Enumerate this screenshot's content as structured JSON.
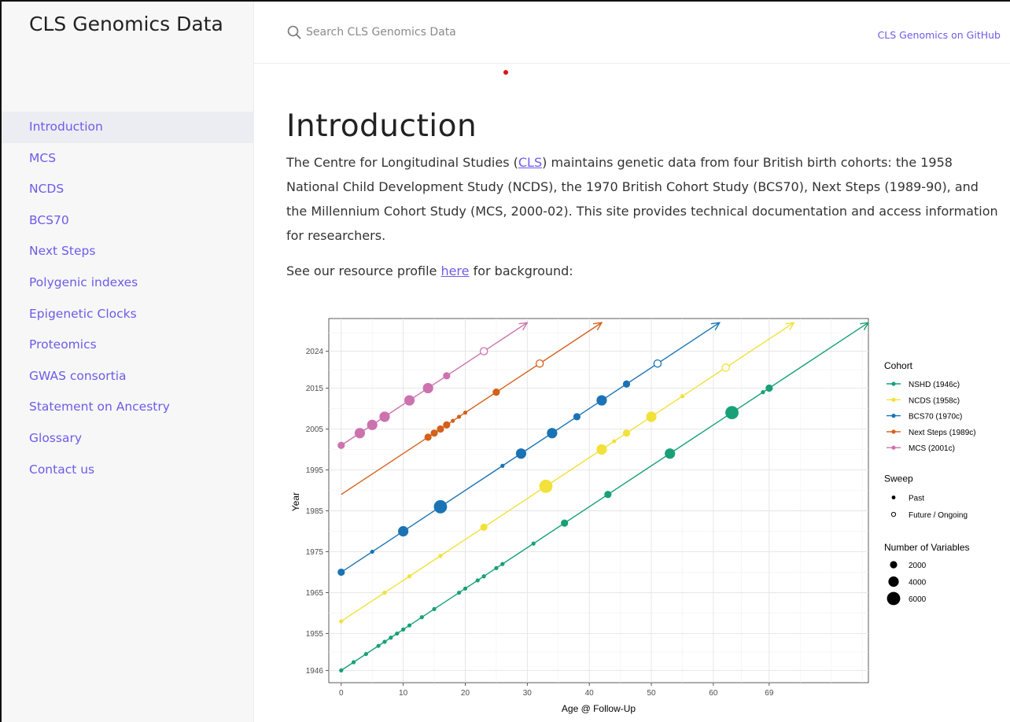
{
  "site": {
    "title": "CLS Genomics Data"
  },
  "search": {
    "placeholder": "Search CLS Genomics Data"
  },
  "header": {
    "github_link": "CLS Genomics on GitHub"
  },
  "sidebar": {
    "items": [
      {
        "label": "Introduction",
        "active": true
      },
      {
        "label": "MCS"
      },
      {
        "label": "NCDS"
      },
      {
        "label": "BCS70"
      },
      {
        "label": "Next Steps"
      },
      {
        "label": "Polygenic indexes"
      },
      {
        "label": "Epigenetic Clocks"
      },
      {
        "label": "Proteomics"
      },
      {
        "label": "GWAS consortia"
      },
      {
        "label": "Statement on Ancestry"
      },
      {
        "label": "Glossary"
      },
      {
        "label": "Contact us"
      }
    ]
  },
  "main": {
    "heading": "Introduction",
    "para1": {
      "before": "The Centre for Longitudinal Studies (",
      "link": "CLS",
      "after": ") maintains genetic data from four British birth cohorts: the 1958 National Child Development Study (NCDS), the 1970 British Cohort Study (BCS70), Next Steps (1989-90), and the Millennium Cohort Study (MCS, 2000-02). This site provides technical documentation and access information for researchers."
    },
    "para2": {
      "before": "See our resource profile ",
      "link": "here",
      "after": " for background:"
    }
  },
  "colors": {
    "accent": "#6d5be8",
    "NSHD": "#18a077",
    "NCDS": "#f1e13a",
    "BCS70": "#1a73b5",
    "NextSteps": "#d4601a",
    "MCS": "#cc73ad"
  },
  "chart_data": {
    "type": "scatter",
    "xlabel": "Age @ Follow-Up",
    "ylabel": "Year",
    "x_ticks": [
      0,
      10,
      20,
      30,
      40,
      50,
      60,
      69
    ],
    "y_ticks": [
      1946,
      1955,
      1965,
      1975,
      1985,
      1995,
      2005,
      2015,
      2024
    ],
    "xlim": [
      -2,
      85
    ],
    "ylim": [
      1943,
      2032
    ],
    "grid": true,
    "legend_cohort_title": "Cohort",
    "legend_sweep_title": "Sweep",
    "legend_size_title": "Number of Variables",
    "sweep_labels": [
      "Past",
      "Future / Ongoing"
    ],
    "size_labels": [
      "2000",
      "4000",
      "6000"
    ],
    "series": [
      {
        "name": "NSHD (1946c)",
        "color_key": "NSHD",
        "birth": 1946,
        "arrow_end_age": 85,
        "points": [
          [
            0,
            0,
            1
          ],
          [
            2,
            0,
            1
          ],
          [
            4,
            0,
            1
          ],
          [
            6,
            0,
            1
          ],
          [
            7,
            0,
            1
          ],
          [
            8,
            0,
            1
          ],
          [
            9,
            0,
            1
          ],
          [
            10,
            0,
            1
          ],
          [
            11,
            0,
            1
          ],
          [
            13,
            0,
            1
          ],
          [
            15,
            0,
            1
          ],
          [
            19,
            0,
            1
          ],
          [
            20,
            0,
            1
          ],
          [
            22,
            0,
            1
          ],
          [
            23,
            0,
            1
          ],
          [
            25,
            0,
            1
          ],
          [
            26,
            0,
            1
          ],
          [
            31,
            0,
            1
          ],
          [
            36,
            0,
            2
          ],
          [
            43,
            0,
            2
          ],
          [
            53,
            0,
            3
          ],
          [
            63,
            0,
            4
          ],
          [
            68,
            0,
            1
          ],
          [
            69,
            0,
            2
          ]
        ]
      },
      {
        "name": "NCDS (1958c)",
        "color_key": "NCDS",
        "birth": 1958,
        "arrow_end_age": 73,
        "points": [
          [
            0,
            0,
            1
          ],
          [
            7,
            0,
            1
          ],
          [
            11,
            0,
            1
          ],
          [
            16,
            0,
            1
          ],
          [
            23,
            0,
            2
          ],
          [
            33,
            0,
            4
          ],
          [
            42,
            0,
            3
          ],
          [
            44,
            0,
            1
          ],
          [
            46,
            0,
            2
          ],
          [
            50,
            0,
            3
          ],
          [
            55,
            0,
            1
          ],
          [
            62,
            1,
            2
          ]
        ]
      },
      {
        "name": "BCS70 (1970c)",
        "color_key": "BCS70",
        "birth": 1970,
        "arrow_end_age": 61,
        "points": [
          [
            0,
            0,
            2
          ],
          [
            5,
            0,
            1
          ],
          [
            10,
            0,
            3
          ],
          [
            16,
            0,
            4
          ],
          [
            26,
            0,
            1
          ],
          [
            29,
            0,
            3
          ],
          [
            34,
            0,
            3
          ],
          [
            38,
            0,
            2
          ],
          [
            42,
            0,
            3
          ],
          [
            46,
            0,
            2
          ],
          [
            51,
            1,
            2
          ]
        ]
      },
      {
        "name": "Next Steps (1989c)",
        "color_key": "NextSteps",
        "birth": 1989,
        "arrow_end_age": 42,
        "points": [
          [
            14,
            0,
            2
          ],
          [
            15,
            0,
            2
          ],
          [
            16,
            0,
            2
          ],
          [
            17,
            0,
            2
          ],
          [
            18,
            0,
            1
          ],
          [
            19,
            0,
            1
          ],
          [
            20,
            0,
            1
          ],
          [
            25,
            0,
            2
          ],
          [
            32,
            1,
            2
          ]
        ]
      },
      {
        "name": "MCS (2001c)",
        "color_key": "MCS",
        "birth": 2001,
        "arrow_end_age": 30,
        "points": [
          [
            0,
            0,
            2
          ],
          [
            3,
            0,
            3
          ],
          [
            5,
            0,
            3
          ],
          [
            7,
            0,
            3
          ],
          [
            11,
            0,
            3
          ],
          [
            14,
            0,
            3
          ],
          [
            17,
            0,
            2
          ],
          [
            23,
            1,
            2
          ]
        ]
      }
    ]
  }
}
